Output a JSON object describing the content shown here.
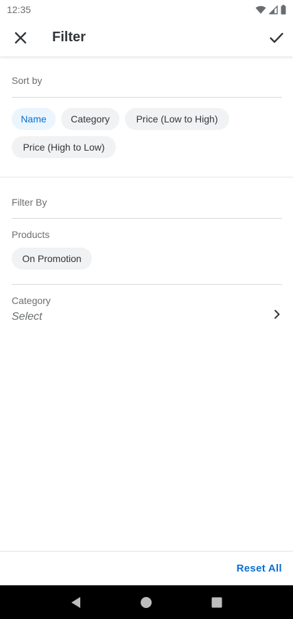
{
  "status_bar": {
    "time": "12:35"
  },
  "header": {
    "title": "Filter",
    "close_icon": "close-icon",
    "confirm_icon": "check-icon"
  },
  "sort": {
    "label": "Sort by",
    "options": [
      {
        "label": "Name",
        "selected": true
      },
      {
        "label": "Category",
        "selected": false
      },
      {
        "label": "Price (Low to High)",
        "selected": false
      },
      {
        "label": "Price (High to Low)",
        "selected": false
      }
    ]
  },
  "filter": {
    "label": "Filter By",
    "products": {
      "label": "Products",
      "chips": [
        {
          "label": "On Promotion",
          "selected": false
        }
      ]
    },
    "category": {
      "label": "Category",
      "value": "Select"
    }
  },
  "footer": {
    "reset_label": "Reset All"
  },
  "colors": {
    "accent": "#0a6ed1",
    "chip_bg": "#f1f2f3",
    "chip_selected_bg": "#ebf5fe",
    "text": "#32363a",
    "muted": "#6a6d70"
  }
}
